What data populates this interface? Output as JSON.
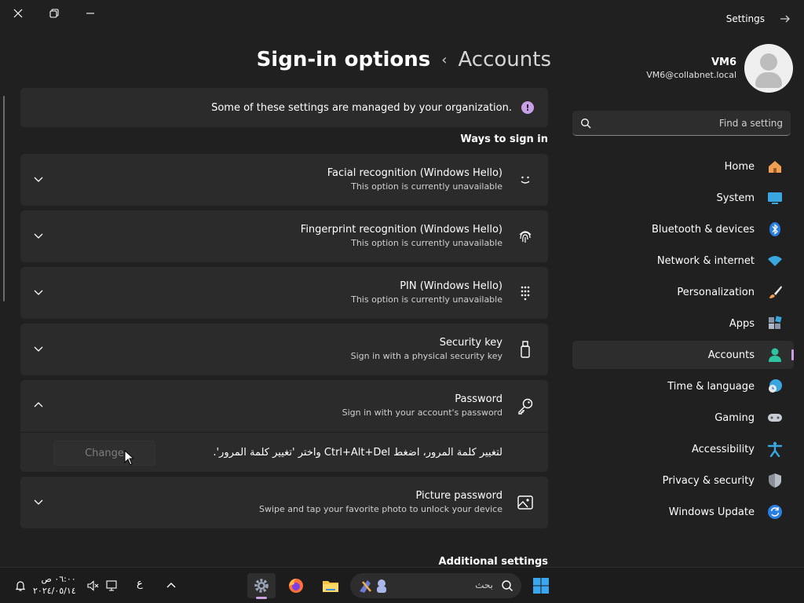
{
  "window": {
    "app_title": "Settings"
  },
  "header": {
    "current": "Sign-in options",
    "separator": "‹",
    "parent": "Accounts"
  },
  "profile": {
    "name": "VM6",
    "email": "VM6@collabnet.local"
  },
  "search": {
    "placeholder": "Find a setting"
  },
  "nav": {
    "items": [
      {
        "label": "Home",
        "icon": "home-icon"
      },
      {
        "label": "System",
        "icon": "monitor-icon"
      },
      {
        "label": "Bluetooth & devices",
        "icon": "bluetooth-icon"
      },
      {
        "label": "Network & internet",
        "icon": "wifi-icon"
      },
      {
        "label": "Personalization",
        "icon": "brush-icon"
      },
      {
        "label": "Apps",
        "icon": "apps-icon"
      },
      {
        "label": "Accounts",
        "icon": "person-icon",
        "active": true
      },
      {
        "label": "Time & language",
        "icon": "globe-clock-icon"
      },
      {
        "label": "Gaming",
        "icon": "gamepad-icon"
      },
      {
        "label": "Accessibility",
        "icon": "accessibility-icon"
      },
      {
        "label": "Privacy & security",
        "icon": "shield-icon"
      },
      {
        "label": "Windows Update",
        "icon": "update-icon"
      }
    ]
  },
  "banner": {
    "text": "Some of these settings are managed by your organization.",
    "icon": "info-icon",
    "icon_glyph": "!"
  },
  "ways": {
    "title": "Ways to sign in",
    "cards": [
      {
        "title": "Facial recognition (Windows Hello)",
        "desc": "This option is currently unavailable",
        "icon": "face-icon"
      },
      {
        "title": "Fingerprint recognition (Windows Hello)",
        "desc": "This option is currently unavailable",
        "icon": "fingerprint-icon"
      },
      {
        "title": "PIN (Windows Hello)",
        "desc": "This option is currently unavailable",
        "icon": "keypad-icon"
      },
      {
        "title": "Security key",
        "desc": "Sign in with a physical security key",
        "icon": "usb-key-icon"
      },
      {
        "title": "Password",
        "desc": "Sign in with your account's password",
        "icon": "key-icon",
        "expanded": true
      },
      {
        "title": "Picture password",
        "desc": "Swipe and tap your favorite photo to unlock your device",
        "icon": "picture-icon"
      }
    ],
    "password_panel": {
      "text": "لتغيير كلمة المرور، اضغط Ctrl+Alt+Del واختر 'تغيير كلمة المرور'.",
      "button": "Change"
    }
  },
  "additional": {
    "title": "Additional settings"
  },
  "taskbar": {
    "clock_time": "٠٦:٠٠ ص",
    "clock_date": "٢٠٢٤/٠٥/١٤",
    "lang": "ع",
    "search_text": "بحث"
  },
  "colors": {
    "accent": "#c9a2e6",
    "background": "#202020",
    "card": "#2b2b2b"
  }
}
